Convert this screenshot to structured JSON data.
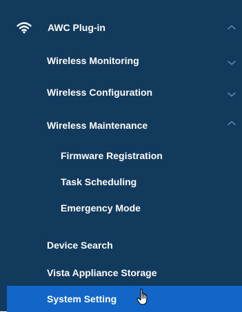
{
  "nav": {
    "plugin": {
      "label": "AWC Plug-in",
      "icon": "wifi-icon",
      "expanded": true
    },
    "wireless_monitoring": {
      "label": "Wireless Monitoring",
      "expanded": false
    },
    "wireless_configuration": {
      "label": "Wireless Configuration",
      "expanded": false
    },
    "wireless_maintenance": {
      "label": "Wireless Maintenance",
      "expanded": true,
      "children": [
        {
          "label": "Firmware Registration"
        },
        {
          "label": "Task Scheduling"
        },
        {
          "label": "Emergency Mode"
        }
      ]
    },
    "device_search": {
      "label": "Device Search"
    },
    "vista_appliance_storage": {
      "label": "Vista Appliance Storage"
    },
    "system_setting": {
      "label": "System Setting",
      "active": true
    }
  },
  "colors": {
    "sidebar_bg": "#113a5d",
    "active_bg": "#1166c8",
    "text": "#ffffff",
    "chevron": "#5d86ab"
  }
}
